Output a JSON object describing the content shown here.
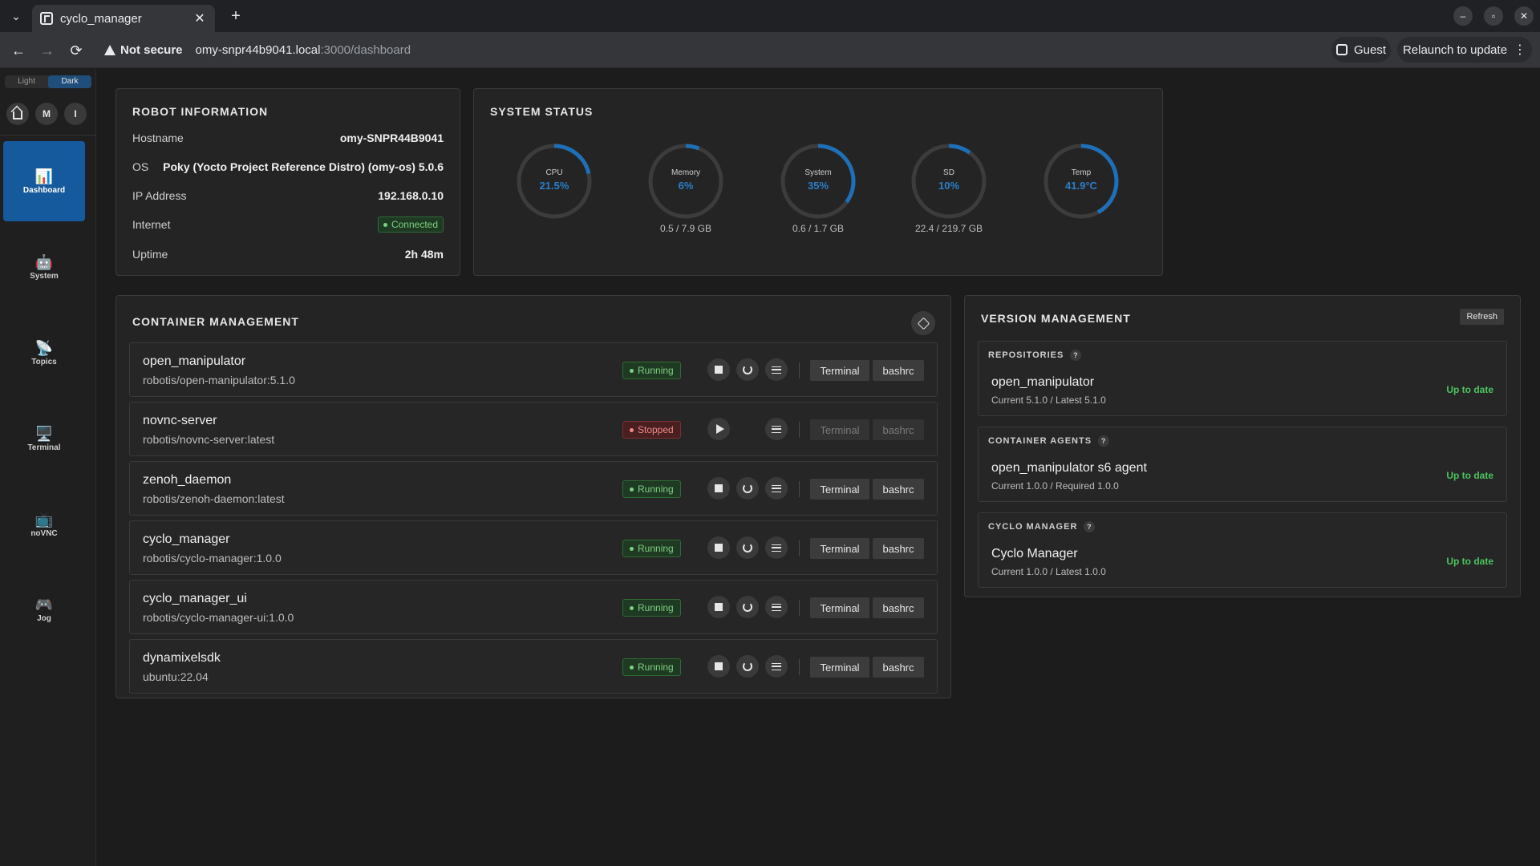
{
  "browser": {
    "tab_title": "cyclo_manager",
    "tab_close": "✕",
    "new_tab": "+",
    "tab_list": "⌄",
    "window_controls": [
      "–",
      "▫",
      "✕"
    ],
    "back": "←",
    "forward": "→",
    "reload": "⟳",
    "security_label": "Not secure",
    "url_host": "omy-snpr44b9041.local",
    "url_path": ":3000/dashboard",
    "profile_label": "Guest",
    "relaunch_label": "Relaunch to update",
    "menu": "⋮"
  },
  "sidebar": {
    "theme": {
      "light": "Light",
      "dark": "Dark",
      "active": "dark"
    },
    "quick_buttons": [
      "M",
      "I"
    ],
    "items": [
      {
        "label": "Dashboard",
        "icon": "📊",
        "icon_name": "chart-icon",
        "active": true
      },
      {
        "label": "System",
        "icon": "🤖",
        "icon_name": "robot-icon"
      },
      {
        "label": "Topics",
        "icon": "📡",
        "icon_name": "antenna-icon"
      },
      {
        "label": "Terminal",
        "icon": "🖥️",
        "icon_name": "monitor-icon"
      },
      {
        "label": "noVNC",
        "icon": "📺",
        "icon_name": "tv-icon"
      },
      {
        "label": "Jog",
        "icon": "🎮",
        "icon_name": "gamepad-icon"
      }
    ]
  },
  "robot_info": {
    "title": "ROBOT INFORMATION",
    "rows": [
      {
        "label": "Hostname",
        "value": "omy-SNPR44B9041"
      },
      {
        "label": "OS",
        "value": "Poky (Yocto Project Reference Distro) (omy-os) 5.0.6"
      },
      {
        "label": "IP Address",
        "value": "192.168.0.10"
      },
      {
        "label": "Internet",
        "value": "Connected"
      },
      {
        "label": "Uptime",
        "value": "2h 48m"
      }
    ]
  },
  "system_status": {
    "title": "SYSTEM STATUS",
    "gauges": [
      {
        "label": "CPU",
        "value": "21.5%",
        "fraction": 0.215,
        "sub": ""
      },
      {
        "label": "Memory",
        "value": "6%",
        "fraction": 0.06,
        "sub": "0.5 / 7.9 GB"
      },
      {
        "label": "System",
        "value": "35%",
        "fraction": 0.35,
        "sub": "0.6 / 1.7 GB"
      },
      {
        "label": "SD",
        "value": "10%",
        "fraction": 0.1,
        "sub": "22.4 / 219.7 GB"
      },
      {
        "label": "Temp",
        "value": "41.9°C",
        "fraction": 0.42,
        "sub": ""
      }
    ],
    "colors": {
      "track": "#3c3c3c",
      "fill": "#1e6fb8"
    }
  },
  "containers": {
    "title": "CONTAINER MANAGEMENT",
    "terminal_label": "Terminal",
    "bashrc_label": "bashrc",
    "items": [
      {
        "name": "open_manipulator",
        "image": "robotis/open-manipulator:5.1.0",
        "status": "Running",
        "running": true
      },
      {
        "name": "novnc-server",
        "image": "robotis/novnc-server:latest",
        "status": "Stopped",
        "running": false
      },
      {
        "name": "zenoh_daemon",
        "image": "robotis/zenoh-daemon:latest",
        "status": "Running",
        "running": true
      },
      {
        "name": "cyclo_manager",
        "image": "robotis/cyclo-manager:1.0.0",
        "status": "Running",
        "running": true
      },
      {
        "name": "cyclo_manager_ui",
        "image": "robotis/cyclo-manager-ui:1.0.0",
        "status": "Running",
        "running": true
      },
      {
        "name": "dynamixelsdk",
        "image": "ubuntu:22.04",
        "status": "Running",
        "running": true
      }
    ]
  },
  "versions": {
    "title": "VERSION MANAGEMENT",
    "refresh_label": "Refresh",
    "help_glyph": "?",
    "cards": [
      {
        "heading": "REPOSITORIES",
        "name": "open_manipulator",
        "version": "Current 5.1.0 / Latest 5.1.0",
        "status": "Up to date"
      },
      {
        "heading": "CONTAINER AGENTS",
        "name": "open_manipulator s6 agent",
        "version": "Current 1.0.0 / Required 1.0.0",
        "status": "Up to date"
      },
      {
        "heading": "CYCLO MANAGER",
        "name": "Cyclo Manager",
        "version": "Current 1.0.0 / Latest 1.0.0",
        "status": "Up to date"
      }
    ]
  }
}
